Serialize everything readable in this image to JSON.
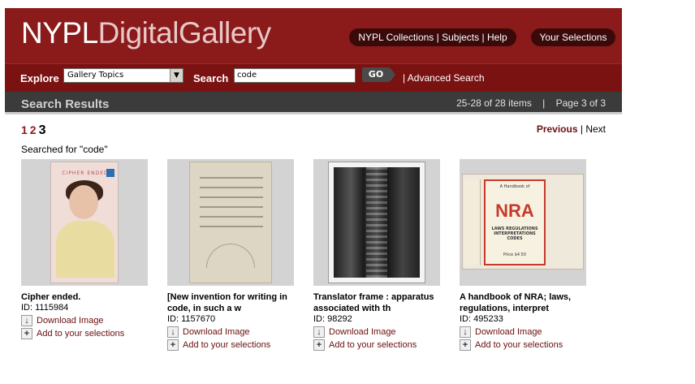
{
  "header": {
    "logo_bold": "NYPL",
    "logo_thin": "DigitalGallery",
    "nav": [
      "NYPL Collections",
      "Subjects",
      "Help"
    ],
    "nav_sep": " | ",
    "selections": "Your Selections",
    "brand_color": "#8b1a1a"
  },
  "searchbar": {
    "explore_label": "Explore",
    "explore_value": "Gallery Topics",
    "search_label": "Search",
    "search_value": "code",
    "go_label": "GO",
    "advanced": "| Advanced Search"
  },
  "results": {
    "title": "Search Results",
    "info": "25-28 of 28 items    |    Page 3 of 3",
    "pages": [
      "1",
      "2"
    ],
    "current_page": "3",
    "previous": "Previous",
    "sep": " | ",
    "next": "Next",
    "searched_for": "Searched for \"code\""
  },
  "items": [
    {
      "title": "Cipher ended.",
      "id": "ID: 1115984",
      "download": "Download Image",
      "add": "Add to your selections",
      "thumb_text": "CIPHER ENDED"
    },
    {
      "title": "[New invention for writing in code, in such a w",
      "id": "ID: 1157670",
      "download": "Download Image",
      "add": "Add to your selections"
    },
    {
      "title": "Translator frame : apparatus associated with th",
      "id": "ID: 98292",
      "download": "Download Image",
      "add": "Add to your selections"
    },
    {
      "title": "A handbook of NRA; laws, regulations, interpret",
      "id": "ID: 495233",
      "download": "Download Image",
      "add": "Add to your selections",
      "thumb_top": "A Handbook of",
      "thumb_big": "NRA",
      "thumb_mid": "LAWS REGULATIONS INTERPRETATIONS CODES",
      "thumb_price": "Price $4.50"
    }
  ]
}
